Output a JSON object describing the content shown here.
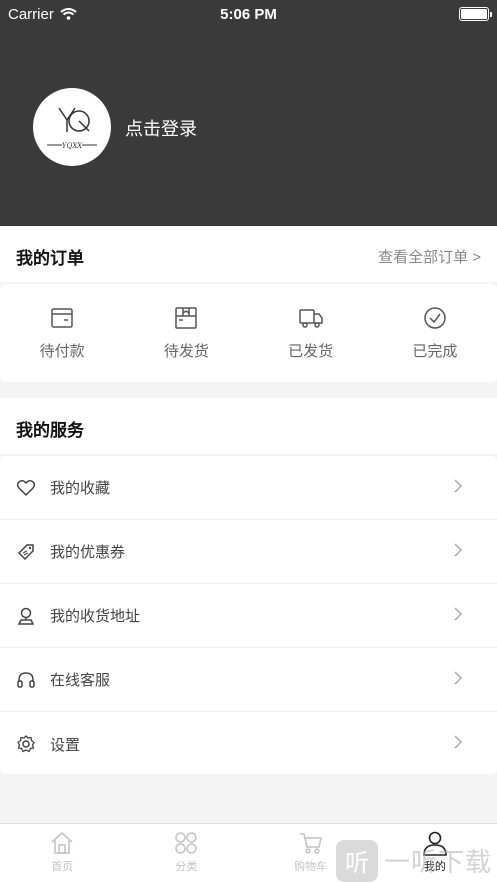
{
  "status": {
    "carrier": "Carrier",
    "time": "5:06 PM"
  },
  "profile": {
    "login_prompt": "点击登录",
    "avatar_text": "YQXX"
  },
  "orders": {
    "title": "我的订单",
    "view_all": "查看全部订单 >",
    "items": [
      {
        "label": "待付款",
        "icon": "wallet-icon"
      },
      {
        "label": "待发货",
        "icon": "package-icon"
      },
      {
        "label": "已发货",
        "icon": "truck-icon"
      },
      {
        "label": "已完成",
        "icon": "check-circle-icon"
      }
    ]
  },
  "services": {
    "title": "我的服务",
    "items": [
      {
        "label": "我的收藏",
        "icon": "heart-icon"
      },
      {
        "label": "我的优惠券",
        "icon": "coupon-icon"
      },
      {
        "label": "我的收货地址",
        "icon": "location-icon"
      },
      {
        "label": "在线客服",
        "icon": "headset-icon"
      },
      {
        "label": "设置",
        "icon": "gear-icon"
      }
    ]
  },
  "tabbar": {
    "items": [
      {
        "label": "首页",
        "icon": "home-icon",
        "active": false
      },
      {
        "label": "分类",
        "icon": "category-icon",
        "active": false
      },
      {
        "label": "购物车",
        "icon": "cart-icon",
        "active": false
      },
      {
        "label": "我的",
        "icon": "user-icon",
        "active": true
      }
    ]
  },
  "watermark": {
    "glyph": "听",
    "text": "一听下载"
  }
}
